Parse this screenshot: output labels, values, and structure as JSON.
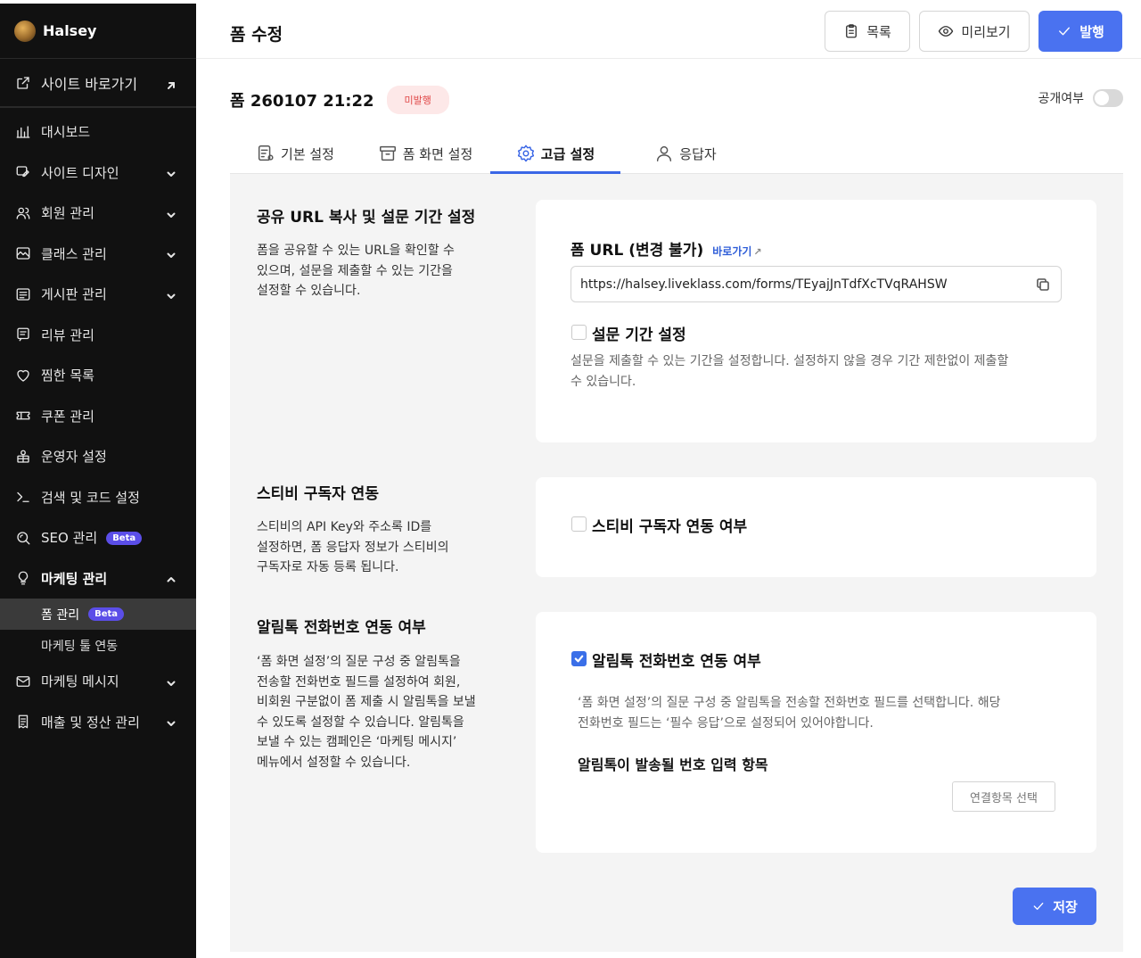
{
  "brand": {
    "name": "Halsey"
  },
  "sidebar": {
    "shortcut_label": "사이트 바로가기",
    "items": [
      {
        "label": "대시보드",
        "icon": "dashboard-icon",
        "chevron": false
      },
      {
        "label": "사이트 디자인",
        "icon": "design-icon",
        "chevron": true
      },
      {
        "label": "회원 관리",
        "icon": "members-icon",
        "chevron": true
      },
      {
        "label": "클래스 관리",
        "icon": "class-icon",
        "chevron": true
      },
      {
        "label": "게시판 관리",
        "icon": "board-icon",
        "chevron": true
      },
      {
        "label": "리뷰 관리",
        "icon": "review-icon",
        "chevron": false
      },
      {
        "label": "찜한 목록",
        "icon": "heart-icon",
        "chevron": false
      },
      {
        "label": "쿠폰 관리",
        "icon": "coupon-icon",
        "chevron": false
      },
      {
        "label": "운영자 설정",
        "icon": "operator-icon",
        "chevron": false
      },
      {
        "label": "검색 및 코드 설정",
        "icon": "terminal-icon",
        "chevron": false
      },
      {
        "label": "SEO 관리",
        "icon": "seo-icon",
        "chevron": false,
        "badge": "Beta"
      },
      {
        "label": "마케팅 관리",
        "icon": "bulb-icon",
        "chevron": true,
        "open": true
      }
    ],
    "sub_items": [
      {
        "label": "폼 관리",
        "badge": "Beta",
        "active": true
      },
      {
        "label": "마케팅 툴 연동",
        "active": false
      }
    ],
    "items_after": [
      {
        "label": "마케팅 메시지",
        "icon": "mail-icon",
        "chevron": true
      },
      {
        "label": "매출 및 정산 관리",
        "icon": "receipt-icon",
        "chevron": true
      }
    ]
  },
  "header": {
    "title": "폼 수정",
    "list_button": "목록",
    "preview_button": "미리보기",
    "publish_button": "발행"
  },
  "form": {
    "name": "폼 260107 21:22",
    "status": "미발행",
    "public_label": "공개여부",
    "public_enabled": false
  },
  "tabs": [
    {
      "label": "기본 설정",
      "icon": "document-settings-icon",
      "active": false
    },
    {
      "label": "폼 화면 설정",
      "icon": "archive-icon",
      "active": false
    },
    {
      "label": "고급 설정",
      "icon": "gear-icon",
      "active": true
    },
    {
      "label": "응답자",
      "icon": "user-icon",
      "active": false
    }
  ],
  "sections": {
    "share": {
      "title": "공유 URL 복사 및 설문 기간 설정",
      "desc_lines": [
        "폼을 공유할 수 있는 URL을 확인할 수",
        "있으며, 설문을 제출할 수 있는 기간을",
        "설정할 수 있습니다."
      ],
      "url_label": "폼 URL (변경 불가)",
      "url_link": "바로가기",
      "url_value": "https://halsey.liveklass.com/forms/TEyajJnTdfXcTVqRAHSW",
      "period_label": "설문 기간 설정",
      "period_checked": false,
      "period_desc_lines": [
        "설문을 제출할 수 있는 기간을 설정합니다. 설정하지 않을 경우 기간 제한없이 제출할",
        "수 있습니다."
      ]
    },
    "stibee": {
      "title": "스티비 구독자 연동",
      "desc_lines": [
        "스티비의 API Key와 주소록 ID를",
        "설정하면, 폼 응답자 정보가 스티비의",
        "구독자로 자동 등록 됩니다."
      ],
      "checkbox_label": "스티비 구독자 연동 여부",
      "checked": false
    },
    "alimtalk": {
      "title": "알림톡 전화번호 연동 여부",
      "desc_lines": [
        "‘폼 화면 설정’의 질문 구성 중 알림톡을",
        "전송할 전화번호 필드를 설정하여 회원,",
        "비회원 구분없이 폼 제출 시 알림톡을 보낼",
        "수 있도록 설정할 수 있습니다. 알림톡을",
        "보낼 수 있는 캠페인은 ‘마케팅 메시지’",
        "메뉴에서 설정할 수 있습니다."
      ],
      "checkbox_label": "알림톡 전화번호 연동 여부",
      "checked": true,
      "help_lines": [
        "‘폼 화면 설정’의 질문 구성 중 알림톡을 전송할 전화번호 필드를 선택합니다. 해당",
        "전화번호 필드는 ‘필수 응답’으로 설정되어 있어야합니다."
      ],
      "field_label": "알림톡이 발송될 번호 입력 항목",
      "select_button": "연결항목 선택"
    }
  },
  "save_button": "저장",
  "colors": {
    "accent": "#4a72f0",
    "sidebar_bg": "#111111",
    "beta": "#5b4ee8",
    "status_bg": "#fde8e8",
    "status_text": "#e04848"
  }
}
